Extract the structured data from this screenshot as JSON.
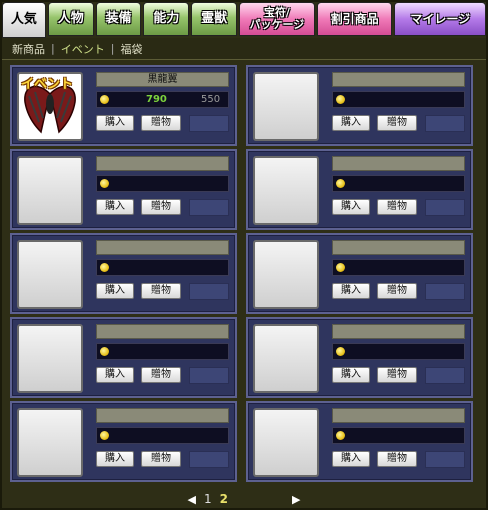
{
  "tabs": [
    {
      "label": "人気",
      "active": true
    },
    {
      "label": "人物"
    },
    {
      "label": "装備"
    },
    {
      "label": "能力"
    },
    {
      "label": "霊獣"
    },
    {
      "label": "宝符/\nパッケージ"
    },
    {
      "label": "割引商品"
    },
    {
      "label": "マイレージ"
    }
  ],
  "subnav": {
    "items": [
      "新商品",
      "イベント",
      "福袋"
    ],
    "active_index": 1
  },
  "items": [
    {
      "name": "黒龍翼",
      "badge": "イベント",
      "price_sale": "790",
      "price_orig": "550",
      "buy": "購入",
      "gift": "贈物"
    },
    {
      "name": "",
      "price_sale": "",
      "price_orig": "",
      "buy": "購入",
      "gift": "贈物"
    },
    {
      "name": "",
      "price_sale": "",
      "price_orig": "",
      "buy": "購入",
      "gift": "贈物"
    },
    {
      "name": "",
      "price_sale": "",
      "price_orig": "",
      "buy": "購入",
      "gift": "贈物"
    },
    {
      "name": "",
      "price_sale": "",
      "price_orig": "",
      "buy": "購入",
      "gift": "贈物"
    },
    {
      "name": "",
      "price_sale": "",
      "price_orig": "",
      "buy": "購入",
      "gift": "贈物"
    },
    {
      "name": "",
      "price_sale": "",
      "price_orig": "",
      "buy": "購入",
      "gift": "贈物"
    },
    {
      "name": "",
      "price_sale": "",
      "price_orig": "",
      "buy": "購入",
      "gift": "贈物"
    },
    {
      "name": "",
      "price_sale": "",
      "price_orig": "",
      "buy": "購入",
      "gift": "贈物"
    },
    {
      "name": "",
      "price_sale": "",
      "price_orig": "",
      "buy": "購入",
      "gift": "贈物"
    }
  ],
  "pager": {
    "prev": "◀",
    "pages": [
      "1",
      "2"
    ],
    "current": "2",
    "next": "▶"
  },
  "colors": {
    "sale_price": "#7cd23c",
    "card_bg": "#2f355e",
    "tab_green": "#97c46c",
    "tab_pink": "#f07ab8",
    "tab_purple": "#b47ae8"
  }
}
